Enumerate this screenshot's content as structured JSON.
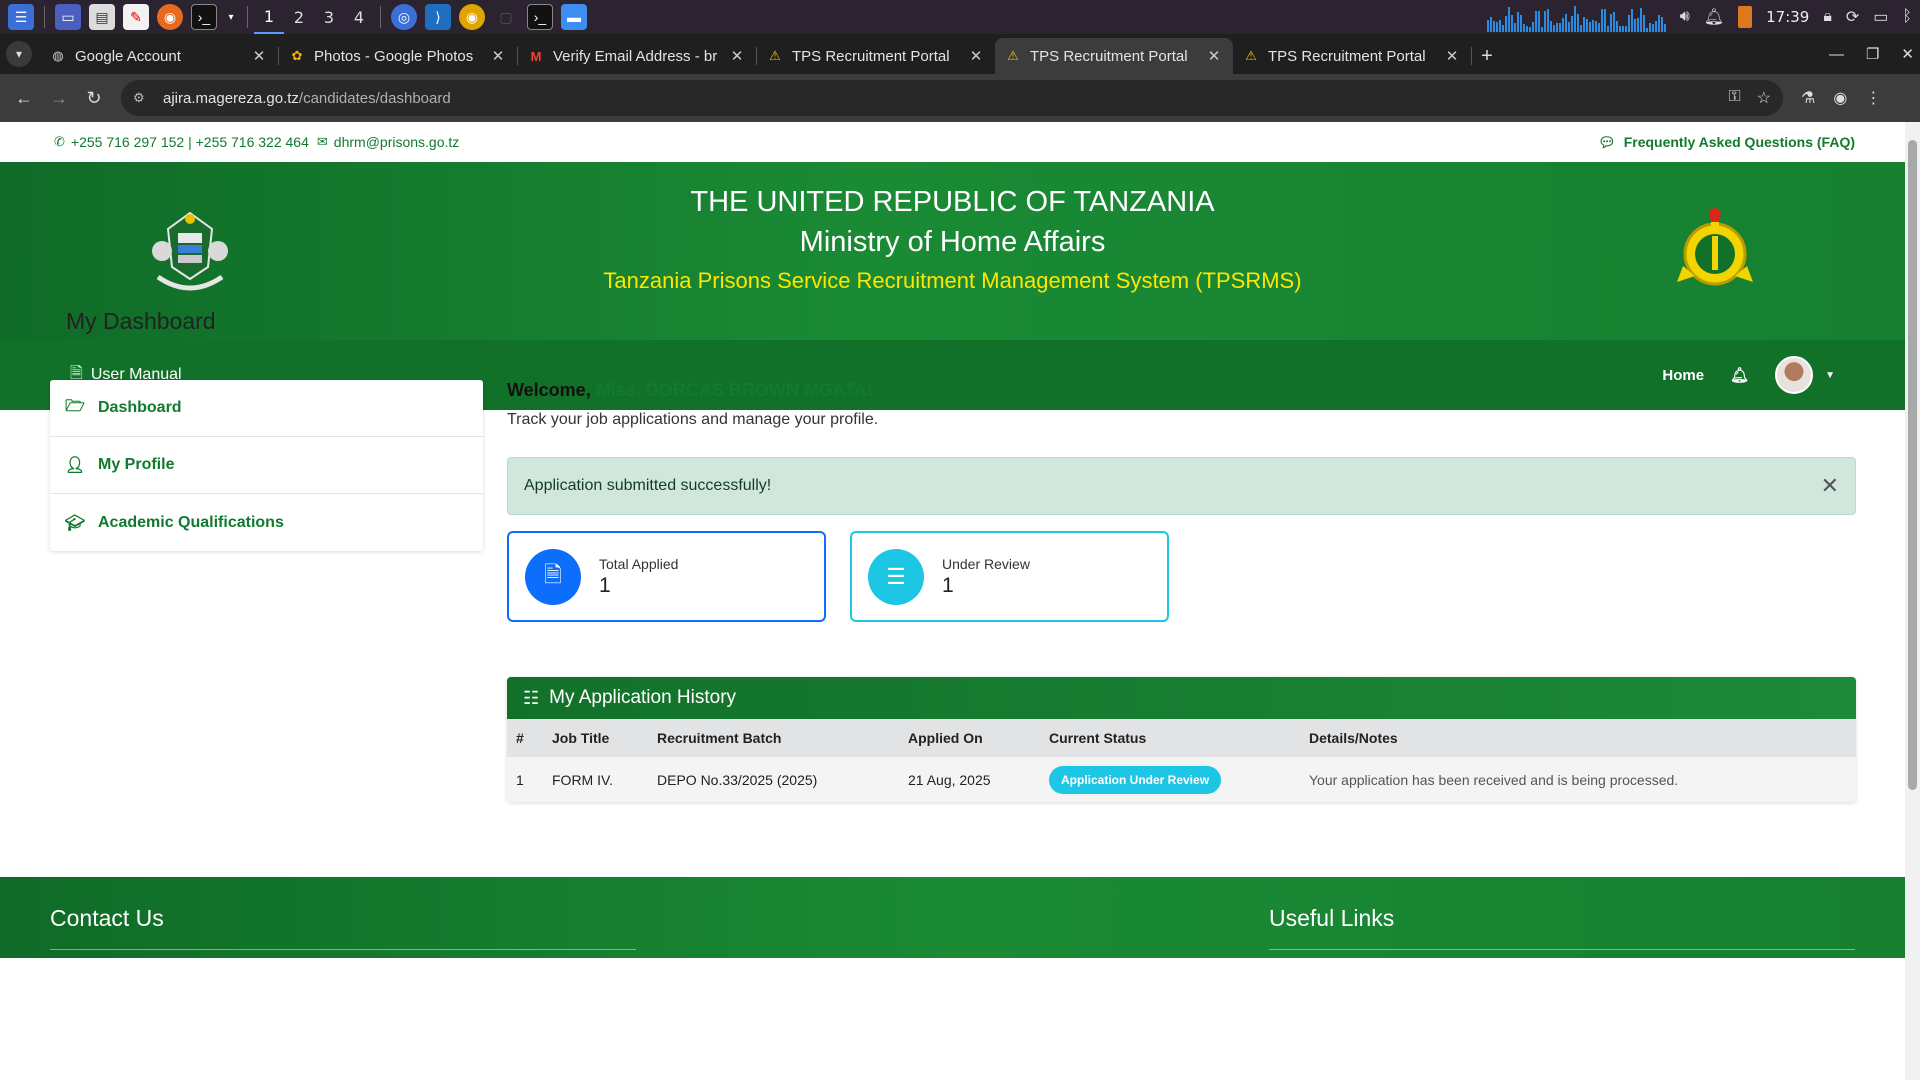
{
  "taskbar": {
    "workspaces": [
      "1",
      "2",
      "3",
      "4"
    ],
    "clock": "17:39"
  },
  "browser": {
    "tabs": [
      {
        "title": "Google Account",
        "icon": "globe-icon"
      },
      {
        "title": "Photos - Google Photos",
        "icon": "photos-icon"
      },
      {
        "title": "Verify Email Address - br",
        "icon": "gmail-icon"
      },
      {
        "title": "TPS Recruitment Portal",
        "icon": "warning-icon"
      },
      {
        "title": "TPS Recruitment Portal",
        "icon": "warning-icon"
      },
      {
        "title": "TPS Recruitment Portal",
        "icon": "warning-icon"
      }
    ],
    "url_domain": "ajira.magereza.go.tz",
    "url_path": "/candidates/dashboard"
  },
  "topbar": {
    "phones": "+255 716 297 152 | +255 716 322 464",
    "email": "dhrm@prisons.go.tz",
    "faq": "Frequently Asked Questions (FAQ)"
  },
  "header": {
    "line1": "THE UNITED REPUBLIC OF TANZANIA",
    "line2": "Ministry of Home Affairs",
    "line3": "Tanzania Prisons Service Recruitment Management System (TPSRMS)"
  },
  "navbar": {
    "user_manual": "User Manual",
    "home": "Home"
  },
  "page_title": "My Dashboard",
  "sidebar": {
    "items": [
      {
        "label": "Dashboard",
        "icon": "folder-open-icon"
      },
      {
        "label": "My Profile",
        "icon": "user-icon"
      },
      {
        "label": "Academic Qualifications",
        "icon": "graduation-cap-icon"
      }
    ]
  },
  "welcome": {
    "prefix": "Welcome, ",
    "name": "Miss. DORCAS BROWN MGATA!",
    "tagline": "Track your job applications and manage your profile."
  },
  "alert": {
    "message": "Application submitted successfully!"
  },
  "stats": [
    {
      "label": "Total Applied",
      "value": "1",
      "icon": "file-icon"
    },
    {
      "label": "Under Review",
      "value": "1",
      "icon": "list-check-icon"
    }
  ],
  "history": {
    "title": "My Application History",
    "columns": [
      "#",
      "Job Title",
      "Recruitment Batch",
      "Applied On",
      "Current Status",
      "Details/Notes"
    ],
    "rows": [
      {
        "num": "1",
        "job_title": "FORM IV.",
        "batch": "DEPO No.33/2025 (2025)",
        "applied_on": "21 Aug, 2025",
        "status": "Application Under Review",
        "notes": "Your application has been received and is being processed."
      }
    ]
  },
  "footer": {
    "contact_title": "Contact Us",
    "links_title": "Useful Links"
  },
  "colors": {
    "brand_green": "#127129",
    "accent_yellow": "#ffe600",
    "primary_blue": "#0d6efd",
    "info_cyan": "#1ec6e6"
  }
}
